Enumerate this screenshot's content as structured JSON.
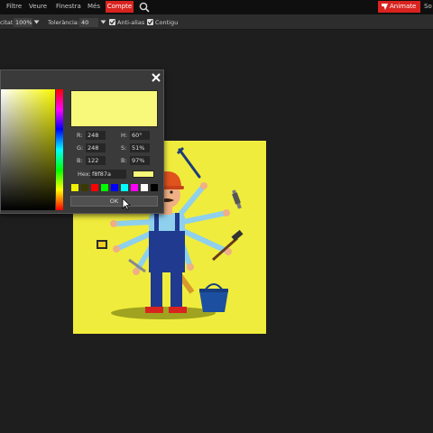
{
  "menubar": {
    "items": [
      "Filtre",
      "Veure",
      "Finestra",
      "Més"
    ],
    "active_item": "Compte",
    "animate_label": "Animate",
    "extra_label": "So"
  },
  "options": {
    "opacity_label": "citat:",
    "opacity_value": "100%",
    "tolerance_label": "Tolerància:",
    "tolerance_value": "40",
    "antialias_label": "Anti-alias",
    "contiguous_label": "Contigu"
  },
  "color_picker": {
    "r_label": "R:",
    "r_value": "248",
    "g_label": "G:",
    "g_value": "248",
    "b_label": "B:",
    "b_value": "122",
    "h_label": "H:",
    "h_value": "60°",
    "s_label": "S:",
    "s_value": "51%",
    "v_label": "B:",
    "v_value": "97%",
    "hex_label": "Hex:",
    "hex_value": "f8f87a",
    "ok_label": "OK",
    "selected_color": "#f8f87a",
    "swatches": [
      "#f0f000",
      "#3a3a00",
      "#ff0000",
      "#00ff00",
      "#0000ff",
      "#00ffff",
      "#ff00ff",
      "#ffffff",
      "#000000"
    ]
  },
  "colors": {
    "accent": "#d9231f",
    "canvas_background": "#f0ec3d"
  }
}
